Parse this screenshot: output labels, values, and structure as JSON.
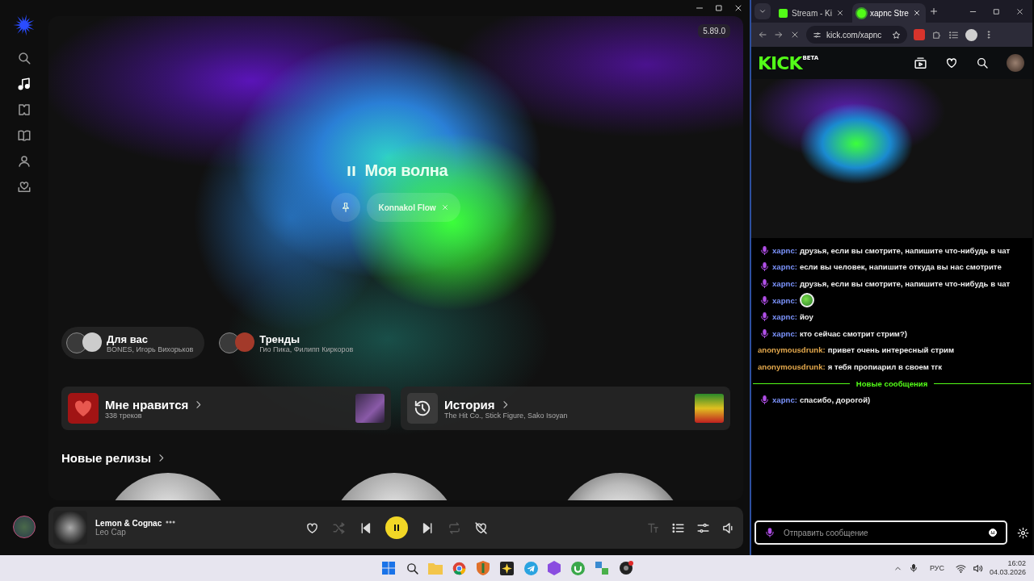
{
  "music_app": {
    "version": "5.89.0",
    "nav": [
      {
        "kind": "search",
        "selected": false
      },
      {
        "kind": "music",
        "selected": true
      },
      {
        "kind": "podcasts",
        "selected": false
      },
      {
        "kind": "books",
        "selected": false
      },
      {
        "kind": "kids",
        "selected": false
      },
      {
        "kind": "collection",
        "selected": false
      }
    ],
    "wave": {
      "title": "Моя волна",
      "playing": true,
      "tag": "Konnakol Flow"
    },
    "mixes": [
      {
        "title": "Для вас",
        "subtitle": "BONES, Игорь Вихорьков",
        "selected": true
      },
      {
        "title": "Тренды",
        "subtitle": "Гио Пика, Филипп Киркоров",
        "selected": false
      }
    ],
    "cards": [
      {
        "kind": "likes",
        "title": "Мне нравится",
        "subtitle": "338 треков"
      },
      {
        "kind": "history",
        "title": "История",
        "subtitle": "The Hit Co., Stick Figure, Sako Isoyan"
      }
    ],
    "section": {
      "title": "Новые релизы"
    },
    "player": {
      "title": "Lemon & Cognac",
      "artist": "Leo Cap",
      "playing": true,
      "controls": [
        {
          "kind": "like",
          "disabled": false
        },
        {
          "kind": "shuffle",
          "disabled": true
        },
        {
          "kind": "prev",
          "disabled": false
        },
        {
          "kind": "play",
          "disabled": false
        },
        {
          "kind": "next",
          "disabled": false
        },
        {
          "kind": "repeat",
          "disabled": true
        },
        {
          "kind": "dislike",
          "disabled": false
        }
      ],
      "tools": [
        {
          "kind": "lyrics",
          "disabled": true
        },
        {
          "kind": "queue",
          "disabled": false
        },
        {
          "kind": "equalizer",
          "disabled": false
        },
        {
          "kind": "volume",
          "disabled": false
        }
      ]
    }
  },
  "browser": {
    "tabs": [
      {
        "title": "Stream - Ki",
        "selected": false
      },
      {
        "title": "xapnc Stre",
        "selected": true
      }
    ],
    "url": "kick.com/xapnc",
    "logo": "KICK",
    "logo_badge": "BETA",
    "chat": [
      {
        "kind": "message",
        "user": "xapnc:",
        "color": "#7d95ff",
        "badge": true,
        "text": "друзья, если вы смотрите, напишите что-нибудь в чат"
      },
      {
        "kind": "message",
        "user": "xapnc:",
        "color": "#7d95ff",
        "badge": true,
        "text": "если вы человек, напишите откуда вы нас смотрите"
      },
      {
        "kind": "message",
        "user": "xapnc:",
        "color": "#7d95ff",
        "badge": true,
        "text": "друзья, если вы смотрите, напишите что-нибудь в чат"
      },
      {
        "kind": "emote",
        "user": "xapnc:",
        "color": "#7d95ff",
        "badge": true
      },
      {
        "kind": "message",
        "user": "xapnc:",
        "color": "#7d95ff",
        "badge": true,
        "text": "йоу"
      },
      {
        "kind": "message",
        "user": "xapnc:",
        "color": "#7d95ff",
        "badge": true,
        "text": "кто сейчас смотрит стрим?)"
      },
      {
        "kind": "message",
        "user": "anonymousdrunk:",
        "color": "#e3a84c",
        "badge": false,
        "text": "привет очень интересный стрим"
      },
      {
        "kind": "message",
        "user": "anonymousdrunk:",
        "color": "#e3a84c",
        "badge": false,
        "text": "я тебя пропиарил в своем тгк"
      },
      {
        "kind": "divider",
        "text": "Новые сообщения"
      },
      {
        "kind": "message",
        "user": "xapnc:",
        "color": "#7d95ff",
        "badge": true,
        "text": "спасибо, дорогой)"
      }
    ],
    "input": {
      "placeholder": "Отправить сообщение"
    }
  },
  "taskbar": {
    "apps": [
      {
        "kind": "start"
      },
      {
        "kind": "search"
      },
      {
        "kind": "folder"
      },
      {
        "kind": "browser"
      },
      {
        "kind": "shield"
      },
      {
        "kind": "spark"
      },
      {
        "kind": "plane"
      },
      {
        "kind": "hexagon"
      },
      {
        "kind": "leaf"
      },
      {
        "kind": "network"
      },
      {
        "kind": "disc"
      }
    ],
    "language": "РУС",
    "time": "16:02",
    "date": "04.03.2026"
  }
}
